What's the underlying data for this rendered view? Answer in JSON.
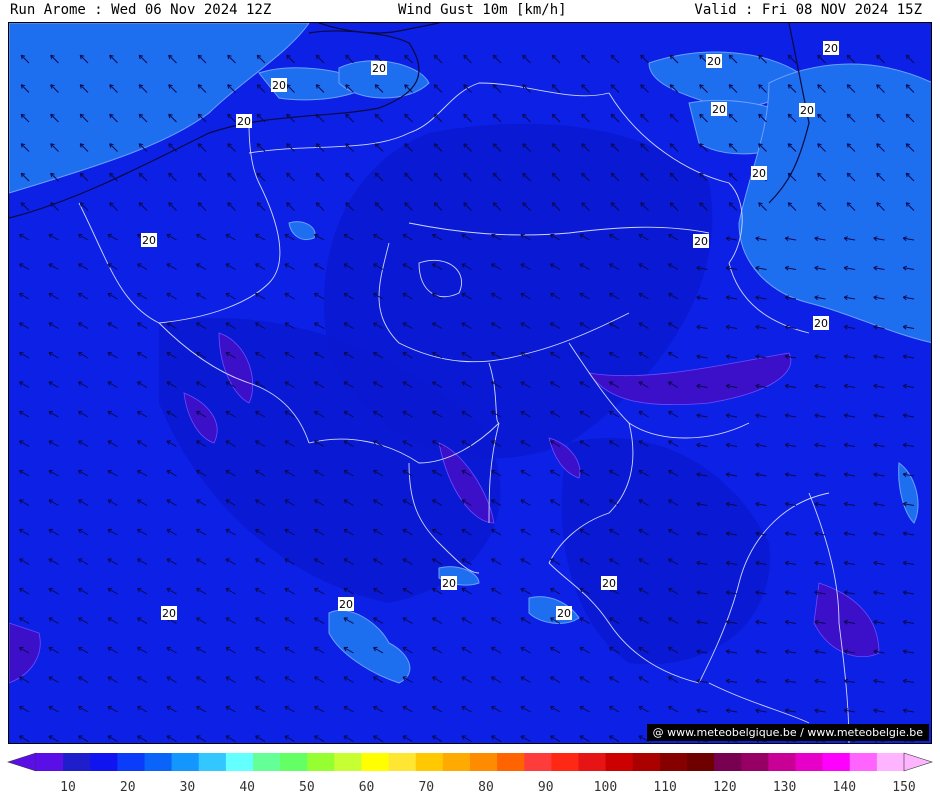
{
  "header": {
    "run": "Run Arome : Wed 06 Nov 2024 12Z",
    "title": "Wind Gust 10m [km/h]",
    "valid": "Valid : Fri 08 NOV 2024 15Z"
  },
  "map": {
    "contour_label": "20",
    "contour_label_count": 16,
    "credit": "@ www.meteobelgique.be / www.meteobelgie.be"
  },
  "legend": {
    "ticks": [
      "10",
      "20",
      "30",
      "40",
      "50",
      "60",
      "70",
      "80",
      "90",
      "100",
      "110",
      "120",
      "130",
      "140",
      "150"
    ],
    "colors": [
      "#5a0fe6",
      "#1e1ecd",
      "#0f14f0",
      "#0a3cfa",
      "#0a64fa",
      "#1496ff",
      "#32c8ff",
      "#64ffff",
      "#64ff96",
      "#64ff64",
      "#96ff32",
      "#c8ff32",
      "#ffff00",
      "#ffe632",
      "#ffc800",
      "#ffaa00",
      "#ff8c00",
      "#ff6400",
      "#ff3c3c",
      "#ff2814",
      "#e61414",
      "#cd0000",
      "#aa0000",
      "#870000",
      "#6e0000",
      "#780050",
      "#960064",
      "#c80096",
      "#e600c8",
      "#ff00ff",
      "#ff64ff",
      "#ffb4ff"
    ]
  },
  "colors": {
    "base": "#0d20e6",
    "gust_20_30": "#1e6ef0",
    "gust_lt_10": "#3c10c8",
    "dark_band": "#0a1ad0",
    "border": "#cfd6ff",
    "coast": "#0a0a3c",
    "arrow": "#0a0a50"
  }
}
